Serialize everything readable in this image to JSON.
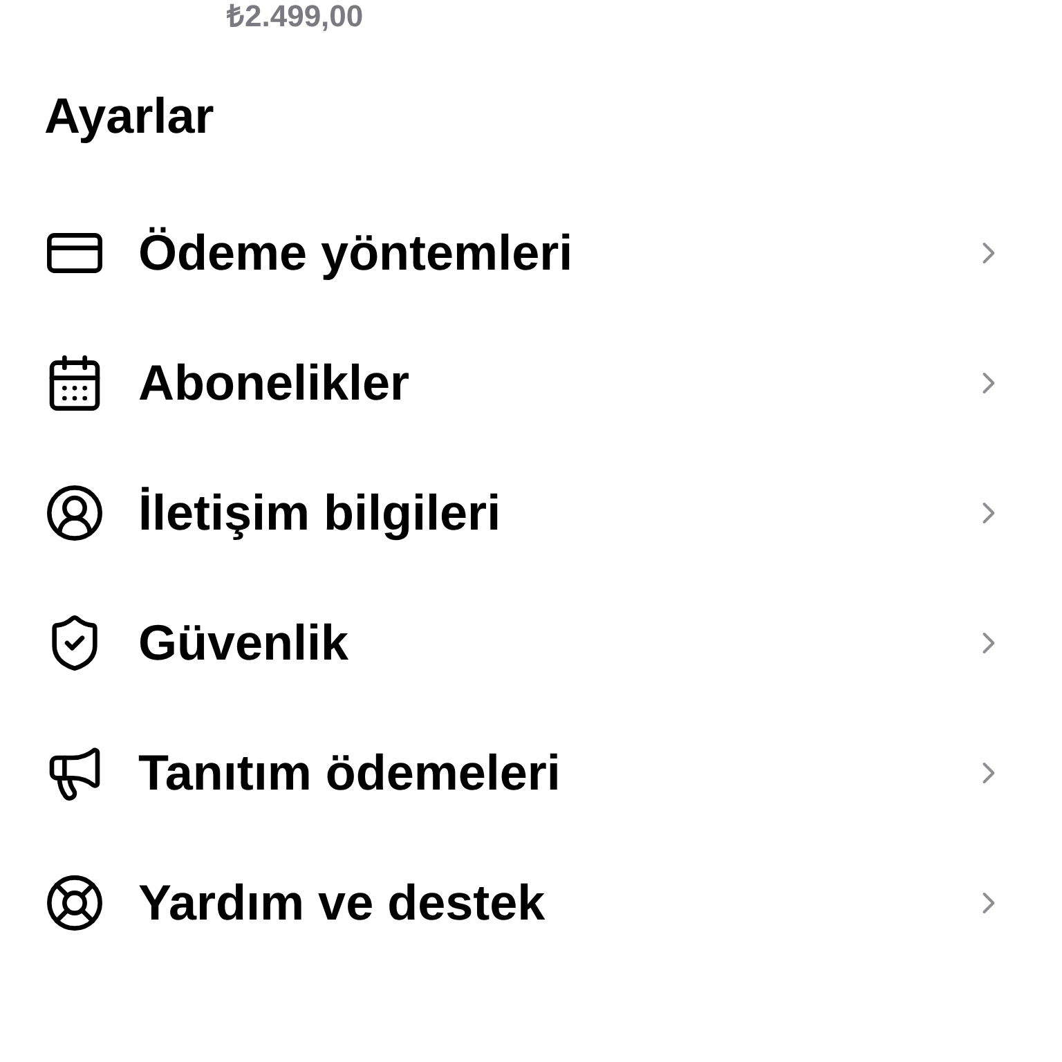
{
  "balance": "₺2.499,00",
  "section_title": "Ayarlar",
  "items": [
    {
      "label": "Ödeme yöntemleri",
      "kind": "card"
    },
    {
      "label": "Abonelikler",
      "kind": "calendar"
    },
    {
      "label": "İletişim bilgileri",
      "kind": "person"
    },
    {
      "label": "Güvenlik",
      "kind": "shield"
    },
    {
      "label": "Tanıtım ödemeleri",
      "kind": "megaphone"
    },
    {
      "label": "Yardım ve destek",
      "kind": "lifebuoy"
    }
  ]
}
